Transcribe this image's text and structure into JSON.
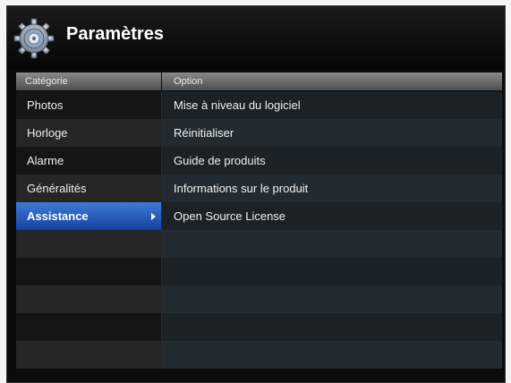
{
  "header": {
    "title": "Paramètres",
    "icon": "gear-icon"
  },
  "columns": {
    "category_label": "Catégorie",
    "option_label": "Option"
  },
  "categories": [
    {
      "label": "Photos",
      "selected": false
    },
    {
      "label": "Horloge",
      "selected": false
    },
    {
      "label": "Alarme",
      "selected": false
    },
    {
      "label": "Généralités",
      "selected": false
    },
    {
      "label": "Assistance",
      "selected": true
    }
  ],
  "options": [
    {
      "label": "Mise à niveau du logiciel"
    },
    {
      "label": "Réinitialiser"
    },
    {
      "label": "Guide de produits"
    },
    {
      "label": "Informations sur le produit"
    },
    {
      "label": "Open Source License"
    }
  ],
  "colors": {
    "selected": "#2a5fc4",
    "background": "#0b0b0b"
  }
}
